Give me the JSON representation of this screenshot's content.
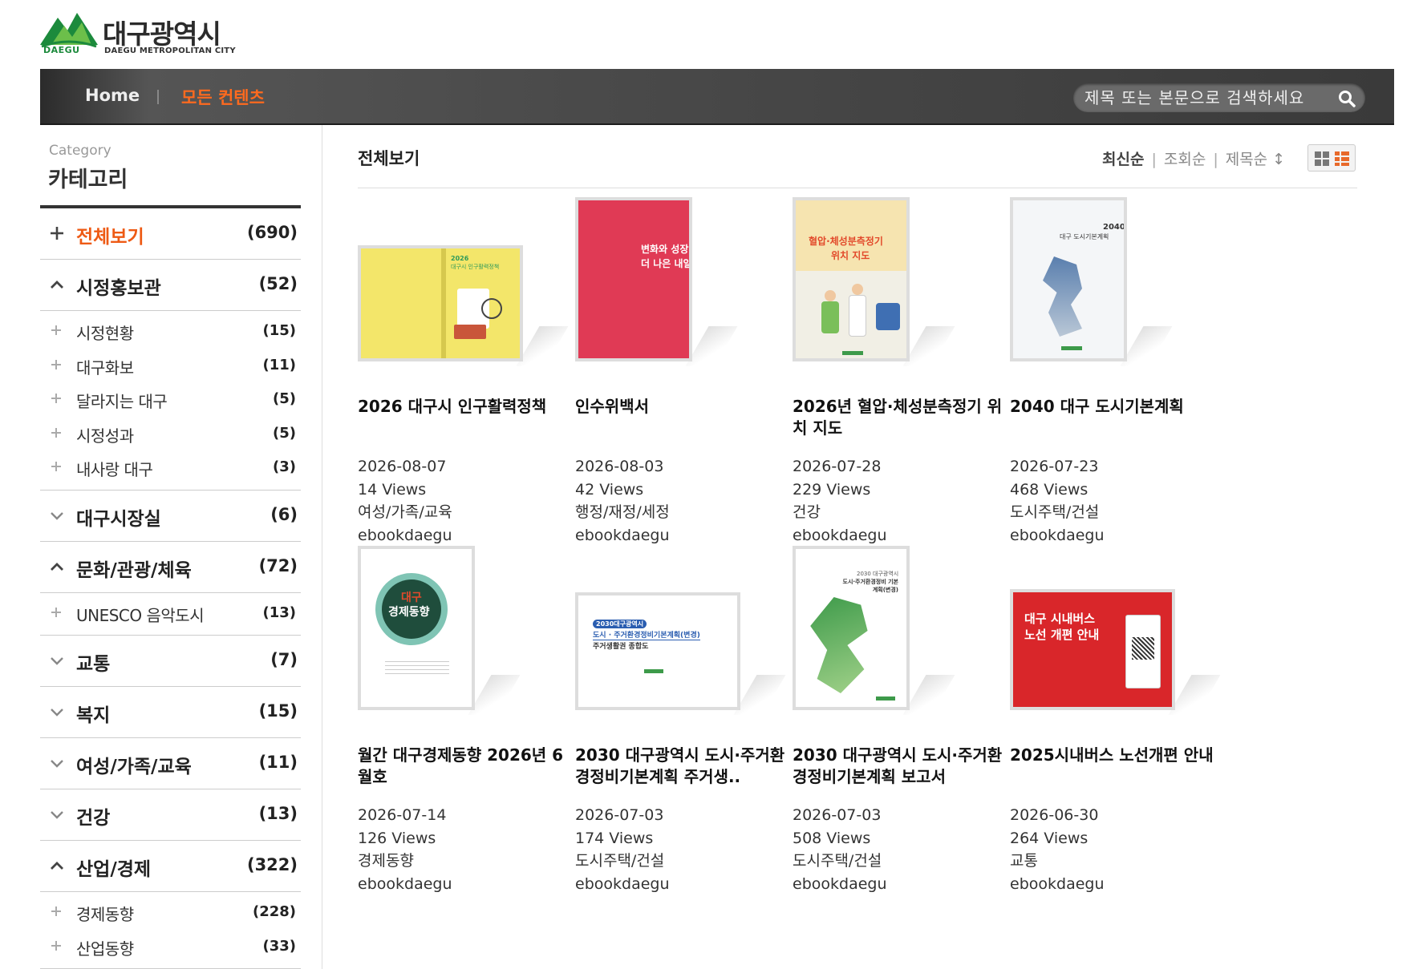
{
  "header": {
    "logo_text_ko": "대구광역시",
    "logo_text_en": "DAEGU METROPOLITAN CITY",
    "logo_mark_text": "DAEGU"
  },
  "nav": {
    "home_label": "Home",
    "current_label": "모든 컨텐츠",
    "search_placeholder": "제목 또는 본문으로 검색하세요"
  },
  "sidebar": {
    "heading_en": "Category",
    "heading_ko": "카테고리",
    "categories": [
      {
        "label": "전체보기",
        "count": "(690)",
        "icon": "plus-icon",
        "active": true
      },
      {
        "label": "시정홍보관",
        "count": "(52)",
        "icon": "chevron-up-icon",
        "children": [
          {
            "label": "시정현황",
            "count": "(15)"
          },
          {
            "label": "대구화보",
            "count": "(11)"
          },
          {
            "label": "달라지는 대구",
            "count": "(5)"
          },
          {
            "label": "시정성과",
            "count": "(5)"
          },
          {
            "label": "내사랑 대구",
            "count": "(3)"
          }
        ]
      },
      {
        "label": "대구시장실",
        "count": "(6)",
        "icon": "chevron-down-icon"
      },
      {
        "label": "문화/관광/체육",
        "count": "(72)",
        "icon": "chevron-up-icon",
        "children": [
          {
            "label": "UNESCO 음악도시",
            "count": "(13)"
          }
        ]
      },
      {
        "label": "교통",
        "count": "(7)",
        "icon": "chevron-down-icon"
      },
      {
        "label": "복지",
        "count": "(15)",
        "icon": "chevron-down-icon"
      },
      {
        "label": "여성/가족/교육",
        "count": "(11)",
        "icon": "chevron-down-icon"
      },
      {
        "label": "건강",
        "count": "(13)",
        "icon": "chevron-down-icon"
      },
      {
        "label": "산업/경제",
        "count": "(322)",
        "icon": "chevron-up-icon",
        "children": [
          {
            "label": "경제동향",
            "count": "(228)"
          },
          {
            "label": "산업동향",
            "count": "(33)"
          }
        ]
      }
    ]
  },
  "main": {
    "title": "전체보기",
    "sort": {
      "latest": "최신순",
      "views": "조회순",
      "title": "제목순 ↕"
    },
    "items": [
      {
        "title": "2026 대구시 인구활력정책",
        "date": "2026-08-07",
        "views": "14 Views",
        "category": "여성/가족/교육",
        "author": "ebookdaegu",
        "cover": {
          "bg": "#f3e66a",
          "accent": "#2e9a5a",
          "text1": "2026",
          "text2": "대구시 인구활력정책"
        }
      },
      {
        "title": "인수위백서",
        "date": "2026-08-03",
        "views": "42 Views",
        "category": "행정/재정/세정",
        "author": "ebookdaegu",
        "cover": {
          "bg": "#e03a55",
          "accent": "#ffffff",
          "text1": "변화와 성장",
          "text2": "더 나은 내일"
        }
      },
      {
        "title": "2026년 혈압·체성분측정기 위치 지도",
        "date": "2026-07-28",
        "views": "229 Views",
        "category": "건강",
        "author": "ebookdaegu",
        "cover": {
          "bg": "#f6e4b0",
          "accent": "#e24a2b",
          "text1": "혈압·체성분측정기",
          "text2": "위치 지도"
        }
      },
      {
        "title": "2040 대구 도시기본계획",
        "date": "2026-07-23",
        "views": "468 Views",
        "category": "도시주택/건설",
        "author": "ebookdaegu",
        "cover": {
          "bg": "#f4f6f8",
          "accent": "#3a5c8c",
          "text1": "2040",
          "text2": "대구 도시기본계획"
        }
      },
      {
        "title": "월간 대구경제동향 2026년 6월호",
        "date": "2026-07-14",
        "views": "126 Views",
        "category": "경제동향",
        "author": "ebookdaegu",
        "cover": {
          "bg": "#ffffff",
          "accent": "#1f4d3c",
          "text1": "대구",
          "text2": "경제동향"
        }
      },
      {
        "title": "2030 대구광역시 도시·주거환경정비기본계획 주거생..",
        "date": "2026-07-03",
        "views": "174 Views",
        "category": "도시주택/건설",
        "author": "ebookdaegu",
        "cover": {
          "bg": "#ffffff",
          "accent": "#2a5db0",
          "text1": "2030대구광역시",
          "text2": "도시 · 주거환경정비기본계획(변경)",
          "text3": "주거생활권 종합도"
        }
      },
      {
        "title": "2030 대구광역시 도시·주거환경정비기본계획 보고서",
        "date": "2026-07-03",
        "views": "508 Views",
        "category": "도시주택/건설",
        "author": "ebookdaegu",
        "cover": {
          "bg": "#ffffff",
          "accent": "#3d9a4a",
          "text1": "2030 대구광역시",
          "text2": "도시·주거환경정비 기본계획(변경)"
        }
      },
      {
        "title": "2025시내버스 노선개편 안내",
        "date": "2026-06-30",
        "views": "264 Views",
        "category": "교통",
        "author": "ebookdaegu",
        "cover": {
          "bg": "#d9262a",
          "accent": "#ffffff",
          "text1": "대구 시내버스",
          "text2": "노선 개편 안내"
        }
      }
    ]
  },
  "colors": {
    "accent_orange": "#ee5a14",
    "nav_dark": "#3a3a3a",
    "logo_green": "#1c8a3c"
  }
}
